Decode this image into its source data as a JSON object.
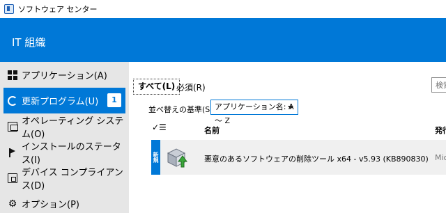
{
  "window": {
    "title": "ソフトウェア センター"
  },
  "header": {
    "org_name": "IT 組織"
  },
  "sidebar": {
    "items": [
      {
        "label": "アプリケーション(A)",
        "icon": "apps-icon"
      },
      {
        "label": "更新プログラム(U)",
        "icon": "refresh-icon",
        "badge": "1",
        "active": true
      },
      {
        "label": "オペレーティング システム(O)",
        "icon": "os-icon"
      },
      {
        "label": "インストールのステータス(I)",
        "icon": "flag-icon"
      },
      {
        "label": "デバイス コンプライアンス(D)",
        "icon": "device-icon"
      },
      {
        "label": "オプション(P)",
        "icon": "gear-icon"
      }
    ]
  },
  "main": {
    "tabs": [
      {
        "label": "すべて(L)",
        "selected": true
      },
      {
        "label": "必須(R)",
        "selected": false
      }
    ],
    "search": {
      "placeholder": "検索"
    },
    "sort": {
      "label": "並べ替えの基準(S):",
      "value": "アプリケーション名: A ～ Z"
    },
    "columns": {
      "check": "✓☰",
      "name": "名前",
      "publisher": "発行"
    },
    "rows": [
      {
        "tag": "新規",
        "name": "悪意のあるソフトウェアの削除ツール x64 - v5.93 (KB890830)",
        "publisher": "Mic"
      }
    ]
  },
  "colors": {
    "accent": "#0078d7",
    "sidebar_bg": "#e6e6e6",
    "row_bg": "#f0f0f0"
  }
}
